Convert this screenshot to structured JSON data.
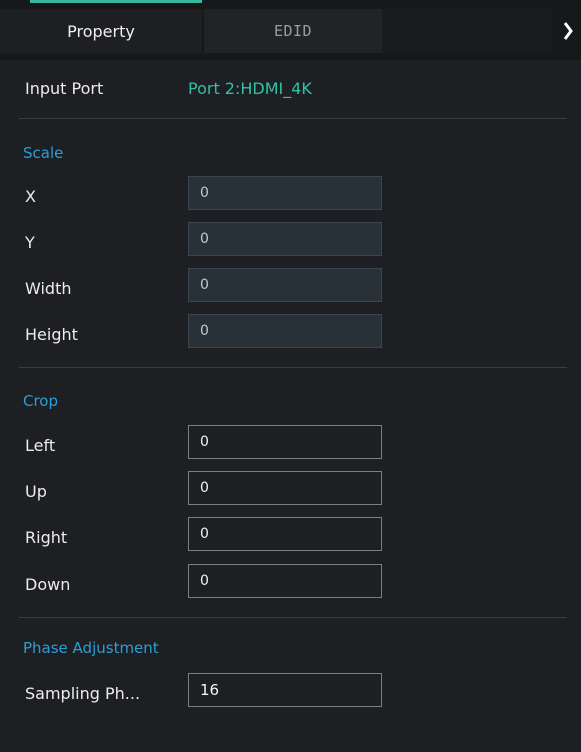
{
  "tabs": [
    {
      "label": "Property"
    },
    {
      "label": "EDID"
    }
  ],
  "input_port": {
    "label": "Input Port",
    "value": "Port 2:HDMI_4K"
  },
  "scale": {
    "title": "Scale",
    "fields": [
      {
        "label": "X",
        "value": "0"
      },
      {
        "label": "Y",
        "value": "0"
      },
      {
        "label": "Width",
        "value": "0"
      },
      {
        "label": "Height",
        "value": "0"
      }
    ]
  },
  "crop": {
    "title": "Crop",
    "fields": [
      {
        "label": "Left",
        "value": "0"
      },
      {
        "label": "Up",
        "value": "0"
      },
      {
        "label": "Right",
        "value": "0"
      },
      {
        "label": "Down",
        "value": "0"
      }
    ]
  },
  "phase": {
    "title": "Phase Adjustment",
    "fields": [
      {
        "label": "Sampling Ph...",
        "value": "16"
      }
    ]
  },
  "colors": {
    "accent_green": "#38b99f",
    "section_blue": "#2a9fd6",
    "background": "#1e1f22"
  },
  "icons": [
    "chevron-left-icon",
    "chevron-right-icon"
  ]
}
